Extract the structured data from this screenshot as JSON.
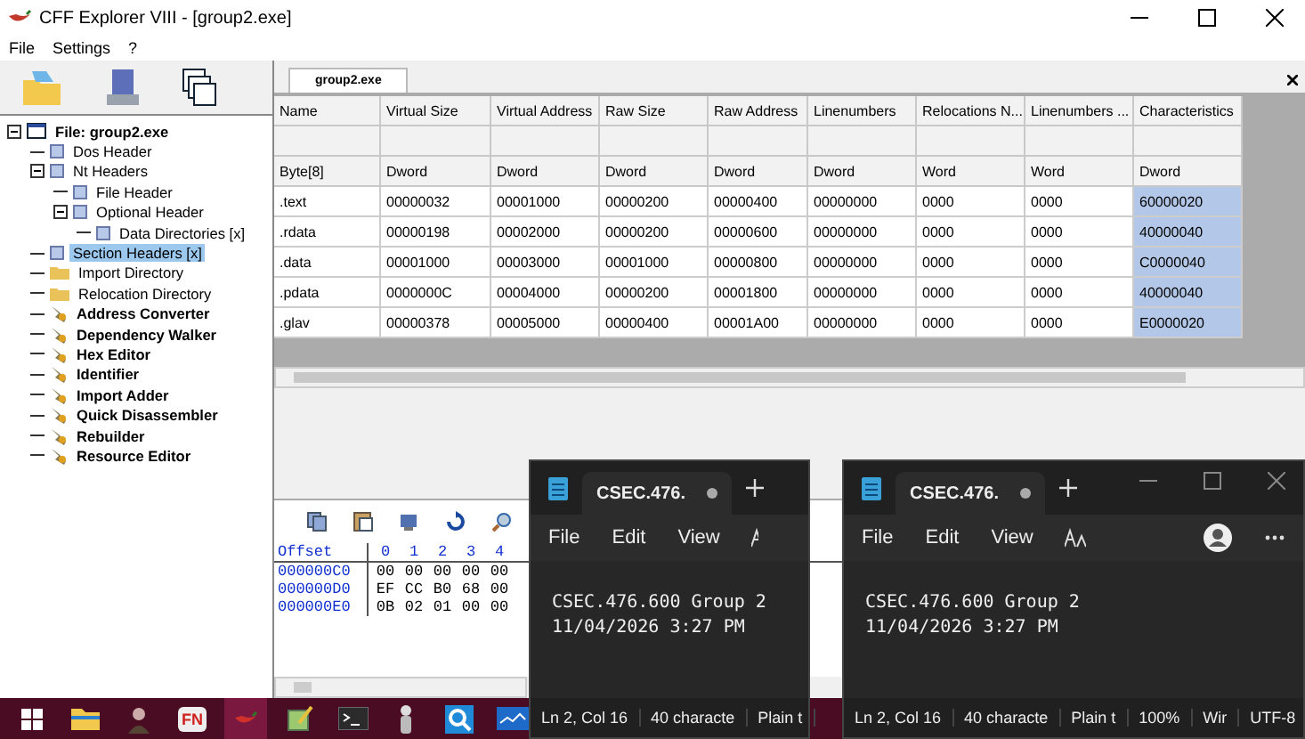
{
  "window": {
    "title": "CFF Explorer VIII - [group2.exe]"
  },
  "menu": [
    "File",
    "Settings",
    "?"
  ],
  "tree": {
    "label": "File: group2.exe",
    "kind": "window",
    "expanded": true,
    "selected": false,
    "children": [
      {
        "label": "Dos Header",
        "kind": "page",
        "selected": false
      },
      {
        "label": "Nt Headers",
        "kind": "page",
        "expanded": true,
        "selected": false,
        "children": [
          {
            "label": "File Header",
            "kind": "page",
            "selected": false
          },
          {
            "label": "Optional Header",
            "kind": "page",
            "expanded": true,
            "selected": false,
            "children": [
              {
                "label": "Data Directories [x]",
                "kind": "page",
                "selected": false
              }
            ]
          }
        ]
      },
      {
        "label": "Section Headers [x]",
        "kind": "page",
        "selected": true
      },
      {
        "label": "Import Directory",
        "kind": "folder",
        "selected": false
      },
      {
        "label": "Relocation Directory",
        "kind": "folder",
        "selected": false
      },
      {
        "label": "Address Converter",
        "kind": "tool",
        "selected": false
      },
      {
        "label": "Dependency Walker",
        "kind": "tool",
        "selected": false
      },
      {
        "label": "Hex Editor",
        "kind": "tool",
        "selected": false
      },
      {
        "label": "Identifier",
        "kind": "tool",
        "selected": false
      },
      {
        "label": "Import Adder",
        "kind": "tool",
        "selected": false
      },
      {
        "label": "Quick Disassembler",
        "kind": "tool",
        "selected": false
      },
      {
        "label": "Rebuilder",
        "kind": "tool",
        "selected": false
      },
      {
        "label": "Resource Editor",
        "kind": "tool",
        "selected": false
      }
    ]
  },
  "file_tab": {
    "label": "group2.exe"
  },
  "table": {
    "columns": [
      {
        "name": "Name",
        "type": "Byte[8]",
        "selected": false
      },
      {
        "name": "Virtual Size",
        "type": "Dword",
        "selected": false
      },
      {
        "name": "Virtual Address",
        "type": "Dword",
        "selected": false
      },
      {
        "name": "Raw Size",
        "type": "Dword",
        "selected": false
      },
      {
        "name": "Raw Address",
        "type": "Dword",
        "selected": false
      },
      {
        "name": "Linenumbers",
        "type": "Dword",
        "selected": false
      },
      {
        "name": "Relocations N...",
        "type": "Word",
        "selected": false
      },
      {
        "name": "Linenumbers ...",
        "type": "Word",
        "selected": false
      },
      {
        "name": "Characteristics",
        "type": "Dword",
        "selected": true
      }
    ],
    "rows": [
      [
        ".text",
        "00000032",
        "00001000",
        "00000200",
        "00000400",
        "00000000",
        "0000",
        "0000",
        "60000020"
      ],
      [
        ".rdata",
        "00000198",
        "00002000",
        "00000200",
        "00000600",
        "00000000",
        "0000",
        "0000",
        "40000040"
      ],
      [
        ".data",
        "00001000",
        "00003000",
        "00001000",
        "00000800",
        "00000000",
        "0000",
        "0000",
        "C0000040"
      ],
      [
        ".pdata",
        "0000000C",
        "00004000",
        "00000200",
        "00001800",
        "00000000",
        "0000",
        "0000",
        "40000040"
      ],
      [
        ".glav",
        "00000378",
        "00005000",
        "00000400",
        "00001A00",
        "00000000",
        "0000",
        "0000",
        "E0000020"
      ]
    ]
  },
  "hex": {
    "offset_header": "Offset",
    "columns": [
      "0",
      "1",
      "2",
      "3",
      "4"
    ],
    "rows": [
      {
        "offset": "000000C0",
        "bytes": [
          "00",
          "00",
          "00",
          "00",
          "00"
        ]
      },
      {
        "offset": "000000D0",
        "bytes": [
          "EF",
          "CC",
          "B0",
          "68",
          "00"
        ]
      },
      {
        "offset": "000000E0",
        "bytes": [
          "0B",
          "02",
          "01",
          "00",
          "00"
        ]
      }
    ]
  },
  "taskbar": [
    {
      "kind": "windows",
      "selected": false
    },
    {
      "kind": "folder",
      "selected": false
    },
    {
      "kind": "portrait",
      "selected": false
    },
    {
      "kind": "badge",
      "label": "FN",
      "selected": false
    },
    {
      "kind": "pepper",
      "selected": true
    },
    {
      "kind": "notepad",
      "selected": false
    },
    {
      "kind": "terminal",
      "selected": false
    },
    {
      "kind": "figure",
      "selected": false
    },
    {
      "kind": "magnifier",
      "selected": false
    },
    {
      "kind": "monitor",
      "selected": false
    }
  ],
  "notepads": [
    {
      "tab_title": "CSEC.476.",
      "unsaved": true,
      "menu": [
        "File",
        "Edit",
        "View"
      ],
      "account": false,
      "window_controls": false,
      "lines": [
        "CSEC.476.600 Group 2",
        "11/04/2026 3:27 PM"
      ],
      "status": [
        "Ln 2, Col 16",
        "40 characte",
        "Plain t"
      ]
    },
    {
      "tab_title": "CSEC.476.",
      "unsaved": true,
      "menu": [
        "File",
        "Edit",
        "View"
      ],
      "account": true,
      "window_controls": true,
      "lines": [
        "CSEC.476.600 Group 2",
        "11/04/2026 3:27 PM"
      ],
      "status": [
        "Ln 2, Col 16",
        "40 characte",
        "Plain t",
        "100%",
        "Wir",
        "UTF-8"
      ]
    }
  ]
}
